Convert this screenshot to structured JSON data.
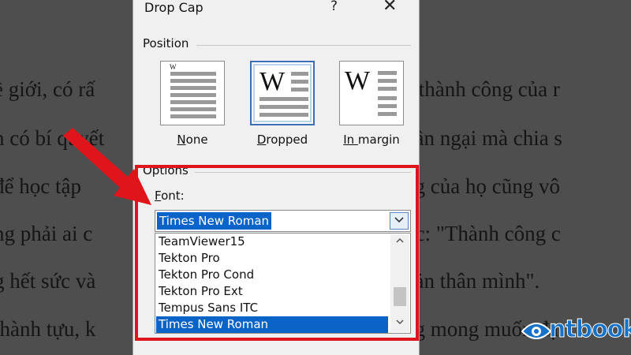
{
  "document": {
    "left_lines": [
      "ề giới, có rấ",
      "n có bí quyết",
      "để học tập",
      "ng phải ai c",
      "g hết sức và",
      "thành tựu, k"
    ],
    "right_lines": [
      "c thành công của r",
      "gần ngại mà chia s",
      "ng của họ cũng vô",
      "ực: \"Thành công c",
      "bản thân mình\".",
      "ng mong muốn đạt"
    ]
  },
  "dialog": {
    "title": "Drop Cap",
    "help_label": "?",
    "close_label": "✕",
    "position_group": "Position",
    "positions": [
      {
        "label": "None",
        "mnemonic": "N",
        "rest": "one",
        "selected": false
      },
      {
        "label": "Dropped",
        "mnemonic": "D",
        "rest": "ropped",
        "selected": true
      },
      {
        "label": "In margin",
        "mnemonic": "In ",
        "rest": "margin",
        "selected": false
      }
    ],
    "options_group": "Options",
    "font_label": "Font:",
    "font_label_mnemonic": "F",
    "font_label_rest": "ont:",
    "font_value": "Times New Roman",
    "font_list": [
      "TeamViewer15",
      "Tekton Pro",
      "Tekton Pro Cond",
      "Tekton Pro Ext",
      "Tempus Sans ITC",
      "Times New Roman"
    ],
    "selected_font_index": 5
  },
  "colors": {
    "highlight": "#0a64c8",
    "annotation_red": "#e0141b",
    "logo_blue": "#1572c8"
  },
  "logo": {
    "text": "ntbook"
  },
  "icons": {
    "dropdown": "chevron-down-icon",
    "scroll_up": "chevron-up-icon",
    "scroll_down": "chevron-down-icon"
  }
}
